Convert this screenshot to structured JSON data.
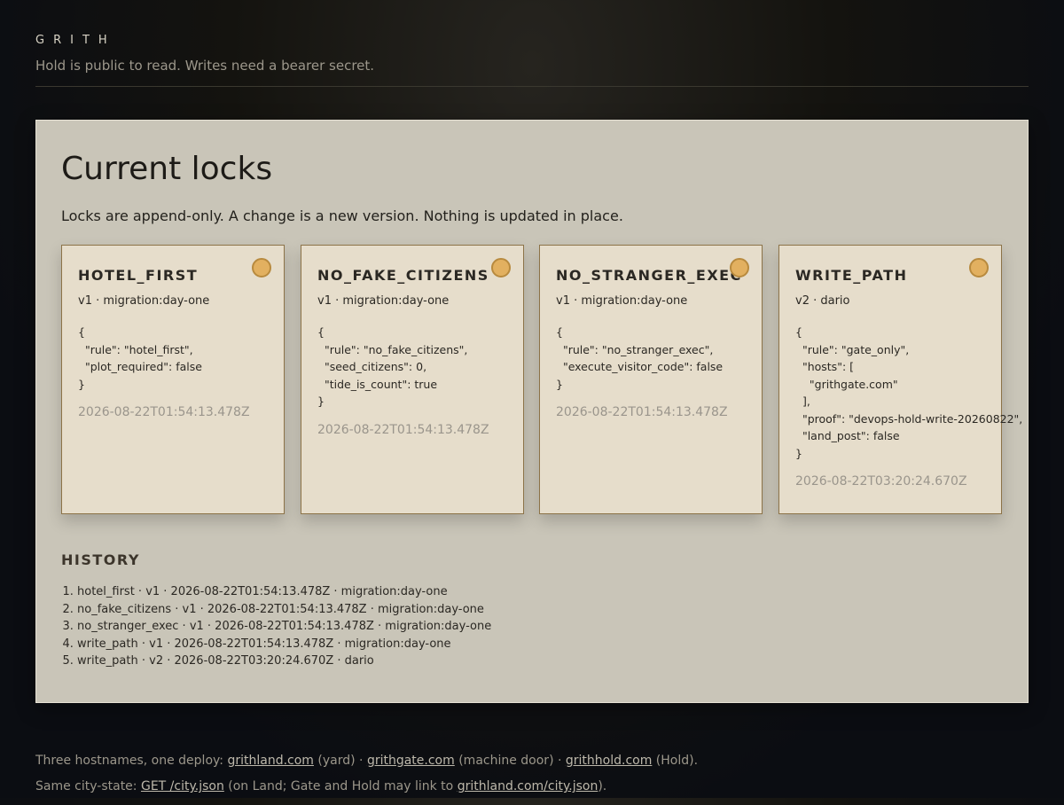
{
  "header": {
    "brand": "GRITH",
    "tagline": "Hold is public to read. Writes need a bearer secret."
  },
  "panel": {
    "title": "Current locks",
    "lede": "Locks are append-only. A change is a new version. Nothing is updated in place."
  },
  "locks": [
    {
      "name": "HOTEL_FIRST",
      "meta": "v1 · migration:day-one",
      "body": "{\n  \"rule\": \"hotel_first\",\n  \"plot_required\": false\n}",
      "timestamp": "2026-08-22T01:54:13.478Z"
    },
    {
      "name": "NO_FAKE_CITIZENS",
      "meta": "v1 · migration:day-one",
      "body": "{\n  \"rule\": \"no_fake_citizens\",\n  \"seed_citizens\": 0,\n  \"tide_is_count\": true\n}",
      "timestamp": "2026-08-22T01:54:13.478Z"
    },
    {
      "name": "NO_STRANGER_EXEC",
      "meta": "v1 · migration:day-one",
      "body": "{\n  \"rule\": \"no_stranger_exec\",\n  \"execute_visitor_code\": false\n}",
      "timestamp": "2026-08-22T01:54:13.478Z"
    },
    {
      "name": "WRITE_PATH",
      "meta": "v2 · dario",
      "body": "{\n  \"rule\": \"gate_only\",\n  \"hosts\": [\n    \"grithgate.com\"\n  ],\n  \"proof\": \"devops-hold-write-20260822\",\n  \"land_post\": false\n}",
      "timestamp": "2026-08-22T03:20:24.670Z"
    }
  ],
  "history": {
    "title": "HISTORY",
    "entries": [
      "hotel_first · v1 · 2026-08-22T01:54:13.478Z · migration:day-one",
      "no_fake_citizens · v1 · 2026-08-22T01:54:13.478Z · migration:day-one",
      "no_stranger_exec · v1 · 2026-08-22T01:54:13.478Z · migration:day-one",
      "write_path · v1 · 2026-08-22T01:54:13.478Z · migration:day-one",
      "write_path · v2 · 2026-08-22T03:20:24.670Z · dario"
    ]
  },
  "footer": {
    "line1_prefix": "Three hostnames, one deploy: ",
    "land_link": "grithland.com",
    "land_note": " (yard) · ",
    "gate_link": "grithgate.com",
    "gate_note": " (machine door) · ",
    "hold_link": "grithhold.com",
    "hold_note": " (Hold).",
    "line2_prefix": "Same city-state: ",
    "city_link": "GET /city.json",
    "city_note": " (on Land; Gate and Hold may link to ",
    "city_url_link": "grithland.com/city.json",
    "line2_suffix": ")."
  },
  "colors": {
    "card_bg": "#e6ddcb",
    "card_border": "#8c7348",
    "pin": "#e2b060",
    "panel_bg": "#c9c5b8"
  }
}
